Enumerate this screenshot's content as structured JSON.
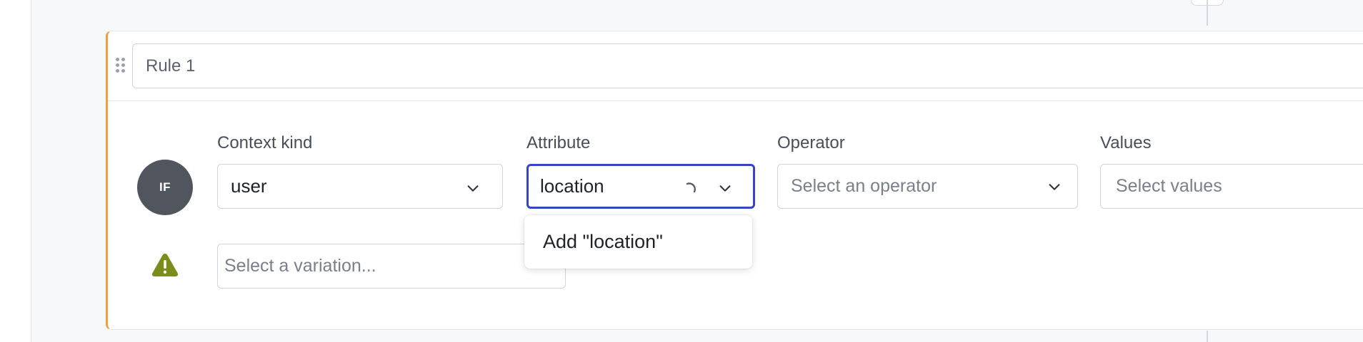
{
  "rule": {
    "name": "Rule 1",
    "if_label": "IF"
  },
  "clause": {
    "context_kind": {
      "label": "Context kind",
      "value": "user"
    },
    "attribute": {
      "label": "Attribute",
      "value": "location",
      "loading": true
    },
    "operator": {
      "label": "Operator",
      "placeholder": "Select an operator"
    },
    "values": {
      "label": "Values",
      "placeholder": "Select values"
    }
  },
  "attribute_dropdown": {
    "options": [
      "Add \"location\""
    ]
  },
  "variation": {
    "placeholder": "Select a variation..."
  },
  "colors": {
    "accent_border": "#f0a036",
    "focus_border": "#3346c7",
    "warning": "#7b8c1a",
    "if_badge": "#50555e"
  },
  "icons": {
    "drag": "drag-handle-icon",
    "chevron": "chevron-down-icon",
    "spinner": "loading-spinner-icon",
    "warning": "warning-triangle-icon"
  }
}
